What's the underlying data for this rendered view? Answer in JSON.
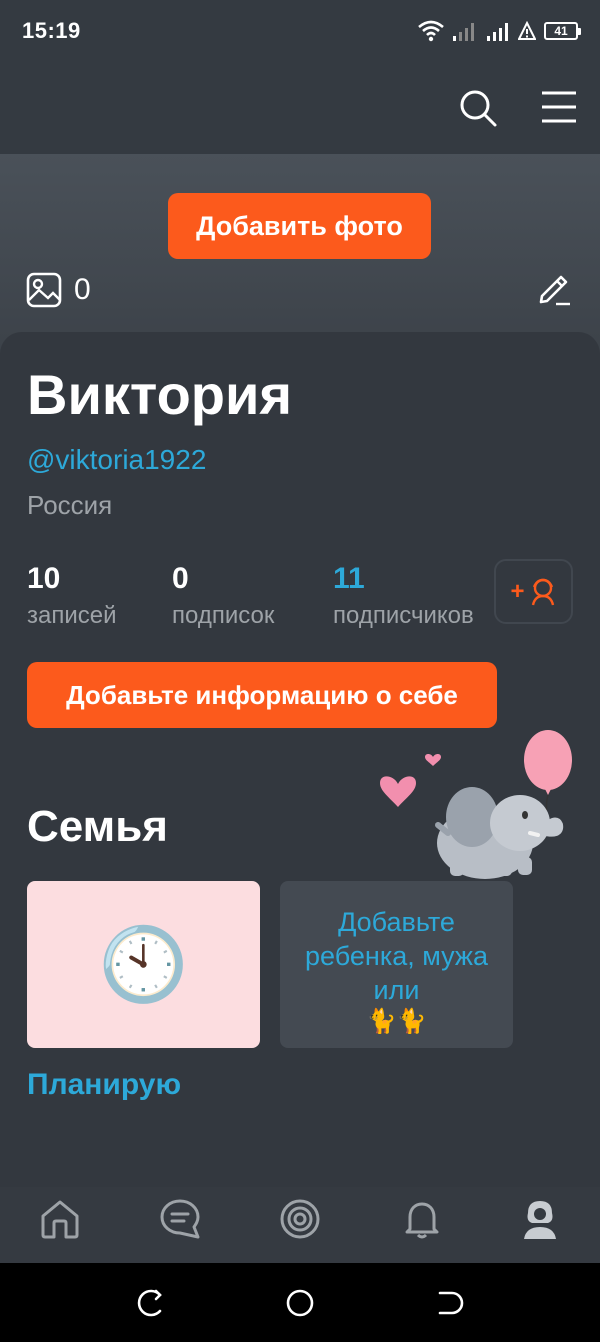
{
  "status_bar": {
    "time": "15:19",
    "battery": "41",
    "icons": [
      "wifi-icon",
      "signal-icon",
      "signal-icon",
      "alert-icon",
      "battery-icon"
    ]
  },
  "top_bar": {
    "icons": [
      "search-icon",
      "menu-icon"
    ]
  },
  "cover": {
    "add_photo_label": "Добавить фото",
    "photo_count": "0",
    "icons": [
      "image-icon",
      "edit-icon"
    ]
  },
  "profile": {
    "name": "Виктория",
    "username": "@viktoria1922",
    "country": "Россия",
    "stats": [
      {
        "value": "10",
        "label": "записей"
      },
      {
        "value": "0",
        "label": "подписок"
      },
      {
        "value": "11",
        "label": "подписчиков"
      }
    ],
    "add_friend_plus": "+",
    "add_info_label": "Добавьте информацию о себе"
  },
  "family": {
    "title": "Семья",
    "card_1_icon": "clock-icon",
    "card_1_emoji": "🕙",
    "card_2_text": "Добавьте ребенка, мужа или",
    "card_2_emoji": "🐈🐈",
    "planning_label": "Планирую"
  },
  "bottom_nav": {
    "items": [
      "home-icon",
      "chat-icon",
      "target-icon",
      "bell-icon",
      "profile-icon"
    ]
  },
  "colors": {
    "accent": "#fc5a1c",
    "link": "#2da9d9",
    "background": "#33383f"
  }
}
